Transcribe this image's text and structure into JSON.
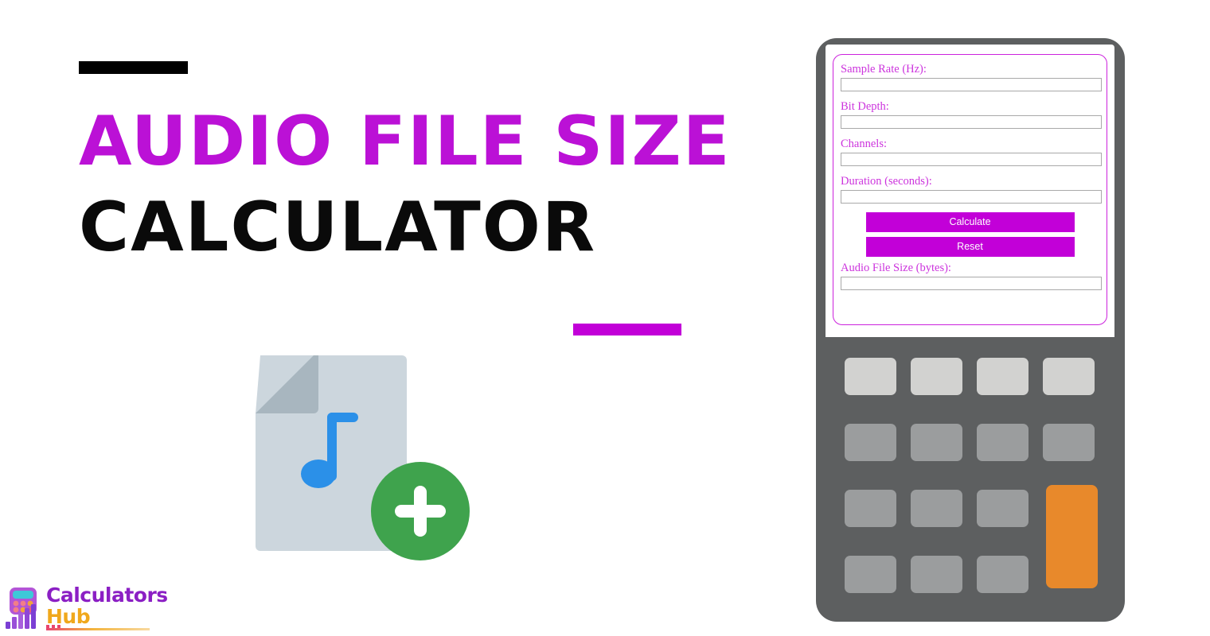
{
  "hero": {
    "title_line1": "AUDIO FILE SIZE",
    "title_line2": "CALCULATOR",
    "title_color": "#bb11d6",
    "title_line2_color": "#0a0a0a",
    "accent_bar_black_color": "#000000",
    "accent_bar_magenta_color": "#c200d8"
  },
  "illustration": {
    "name": "audio-file-add-illustration",
    "document_color": "#ccd6dd",
    "fold_color": "#a8b6bf",
    "note_color": "#2b90e8",
    "badge_color": "#3fa34d",
    "badge_symbol": "+"
  },
  "logo": {
    "word1": "Calculators",
    "word2": "Hub",
    "word1_color": "#8b1fc4",
    "word2_color": "#f0a81c"
  },
  "calculator": {
    "body_color": "#5d5f60",
    "screen_color": "#ffffff",
    "form_border_color": "#cc22dd",
    "label_color": "#cc33dd",
    "button_color": "#c200d8",
    "button_text_color": "#ffffff",
    "fields": [
      {
        "label": "Sample Rate (Hz):",
        "value": "",
        "placeholder": ""
      },
      {
        "label": "Bit Depth:",
        "value": "",
        "placeholder": ""
      },
      {
        "label": "Channels:",
        "value": "",
        "placeholder": ""
      },
      {
        "label": "Duration (seconds):",
        "value": "",
        "placeholder": ""
      }
    ],
    "buttons": [
      {
        "label": "Calculate"
      },
      {
        "label": "Reset"
      }
    ],
    "result": {
      "label": "Audio File Size (bytes):",
      "value": "",
      "placeholder": ""
    },
    "keypad": {
      "rows": 4,
      "cols": 4,
      "light_key_color": "#d2d2d0",
      "key_color": "#9b9d9e",
      "accent_key_color": "#e8892b",
      "accent_key_position": "col4-rows3-4"
    }
  }
}
